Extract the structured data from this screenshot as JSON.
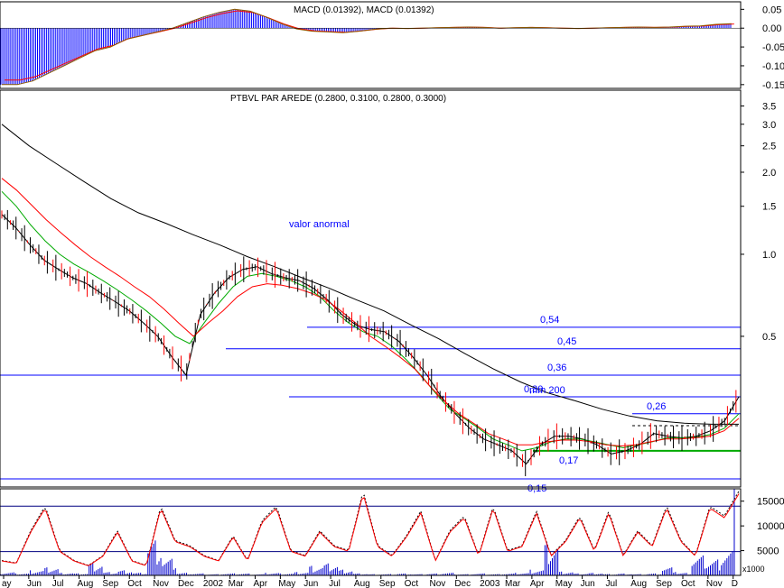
{
  "colors": {
    "blue": "#0000ff",
    "red": "#ff0000",
    "green": "#00aa00",
    "black": "#000000",
    "volume": "#0000cc",
    "grid": "#000080"
  },
  "chart_data": [
    {
      "type": "bar",
      "panel": "macd",
      "title": "MACD (0.01392), MACD (0.01392)",
      "ylim": [
        -0.16,
        0.07
      ],
      "ticks": [
        "0.05",
        "0.00",
        "-0.05",
        "-0.10",
        "-0.15"
      ],
      "tick_values": [
        0.05,
        0.0,
        -0.05,
        -0.1,
        -0.15
      ],
      "series": [
        {
          "values": [
            -0.15,
            -0.15,
            -0.14,
            -0.12,
            -0.1,
            -0.08,
            -0.06,
            -0.05,
            -0.03,
            -0.02,
            -0.01,
            0.0,
            0.015,
            0.03,
            0.042,
            0.05,
            0.045,
            0.03,
            0.012,
            -0.002,
            -0.008,
            -0.01,
            -0.012,
            -0.008,
            -0.003,
            0.0,
            -0.001,
            0.0,
            0.001,
            0.002,
            0.003,
            0.002,
            0.0,
            0.001,
            0.002,
            0.001,
            0.0,
            -0.001,
            0.0,
            0.001,
            0.002,
            0.003,
            0.002,
            0.003,
            0.005,
            0.006,
            0.01,
            0.012
          ]
        }
      ]
    },
    {
      "type": "line",
      "panel": "price",
      "title": "PTBVL PAR AREDE (0.2800, 0.3100, 0.2800, 0.3000)",
      "scale": "log",
      "ylim": [
        0.14,
        4.0
      ],
      "ticks": [
        "3.5",
        "3.0",
        "2.5",
        "2.0",
        "1.5",
        "1.0",
        "0.5"
      ],
      "tick_values": [
        3.5,
        3.0,
        2.5,
        2.0,
        1.5,
        1.0,
        0.5
      ],
      "annotation": "valor anormal",
      "series": [
        {
          "values": [
            1.4,
            1.25,
            1.08,
            0.95,
            0.88,
            0.82,
            0.78,
            0.72,
            0.67,
            0.62,
            0.56,
            0.5,
            0.42,
            0.36,
            0.6,
            0.72,
            0.82,
            0.88,
            0.9,
            0.85,
            0.82,
            0.8,
            0.75,
            0.68,
            0.6,
            0.55,
            0.53,
            0.52,
            0.48,
            0.42,
            0.36,
            0.3,
            0.26,
            0.23,
            0.21,
            0.2,
            0.19,
            0.17,
            0.2,
            0.215,
            0.215,
            0.21,
            0.2,
            0.185,
            0.19,
            0.2,
            0.22,
            0.215,
            0.212,
            0.215,
            0.225,
            0.245,
            0.3
          ]
        },
        {
          "values": [
            1.7,
            1.5,
            1.28,
            1.12,
            1.0,
            0.92,
            0.86,
            0.8,
            0.74,
            0.68,
            0.62,
            0.56,
            0.5,
            0.47,
            0.56,
            0.66,
            0.76,
            0.83,
            0.85,
            0.83,
            0.8,
            0.76,
            0.7,
            0.62,
            0.56,
            0.52,
            0.5,
            0.46,
            0.41,
            0.36,
            0.31,
            0.27,
            0.25,
            0.23,
            0.21,
            0.2,
            0.19,
            0.195,
            0.205,
            0.21,
            0.21,
            0.205,
            0.2,
            0.195,
            0.2,
            0.205,
            0.212,
            0.212,
            0.213,
            0.218,
            0.23,
            0.26
          ]
        },
        {
          "values": [
            1.9,
            1.72,
            1.52,
            1.34,
            1.2,
            1.08,
            0.98,
            0.9,
            0.83,
            0.76,
            0.7,
            0.63,
            0.56,
            0.5,
            0.56,
            0.62,
            0.7,
            0.76,
            0.78,
            0.77,
            0.75,
            0.72,
            0.68,
            0.62,
            0.56,
            0.5,
            0.46,
            0.42,
            0.38,
            0.33,
            0.29,
            0.26,
            0.24,
            0.22,
            0.21,
            0.2,
            0.2,
            0.205,
            0.208,
            0.208,
            0.205,
            0.2,
            0.198,
            0.2,
            0.205,
            0.21,
            0.21,
            0.212,
            0.215,
            0.225,
            0.25
          ]
        },
        {
          "values": [
            3.0,
            2.5,
            2.15,
            1.85,
            1.6,
            1.42,
            1.3,
            1.18,
            1.08,
            0.98,
            0.9,
            0.82,
            0.75,
            0.68,
            0.62,
            0.55,
            0.49,
            0.43,
            0.38,
            0.34,
            0.31,
            0.29,
            0.27,
            0.255,
            0.245,
            0.24,
            0.238,
            0.238
          ]
        }
      ],
      "levels": [
        {
          "label": "0,54",
          "value": 0.54
        },
        {
          "label": "0,45",
          "value": 0.45
        },
        {
          "label": "0,36",
          "value": 0.36
        },
        {
          "label": "0,30",
          "value": 0.3
        },
        {
          "label": "0,26",
          "value": 0.26
        },
        {
          "label": "0,17",
          "value": 0.19
        },
        {
          "label": "0,15",
          "value": 0.15
        }
      ],
      "ma_label": "mm 200"
    },
    {
      "type": "bar",
      "panel": "volume",
      "ylim": [
        0,
        17500
      ],
      "ticks": [
        "15000",
        "10000",
        "5000"
      ],
      "tick_values": [
        15000,
        10000,
        5000
      ],
      "unit_label": "x1000",
      "reference_lines": [
        14000,
        4800
      ],
      "series": [
        {
          "values": [
            3000,
            2500,
            9000,
            14000,
            5000,
            3000,
            2000,
            4000,
            9000,
            3000,
            2000,
            14000,
            7000,
            6000,
            4000,
            3000,
            8000,
            3000,
            11000,
            14000,
            5000,
            4000,
            9000,
            6000,
            5000,
            17000,
            6000,
            4000,
            8000,
            13000,
            3000,
            9000,
            12000,
            4000,
            14000,
            5000,
            6000,
            13000,
            4000,
            7000,
            12000,
            5000,
            13000,
            4000,
            9000,
            6000,
            14000,
            7000,
            4000,
            14000,
            12000,
            17000
          ]
        },
        {
          "values": [
            500,
            300,
            800,
            1200,
            400,
            300,
            2000,
            500,
            800,
            400,
            5500,
            2500,
            400,
            300,
            200,
            300,
            300,
            200,
            400,
            300,
            500,
            1500,
            1800,
            900,
            300,
            200,
            200,
            300,
            200,
            300,
            400,
            200,
            300,
            200,
            300,
            400,
            900,
            5000,
            600,
            300,
            400,
            200,
            300,
            200,
            300,
            1200,
            400,
            3000,
            2500,
            4000,
            17000
          ]
        }
      ],
      "x_labels": [
        "ay",
        "Jun",
        "Jul",
        "Aug",
        "Sep",
        "Oct",
        "Nov",
        "Dec",
        "2002",
        "Mar",
        "Apr",
        "May",
        "Jun",
        "Jul",
        "Aug",
        "Sep",
        "Oct",
        "Nov",
        "Dec",
        "2003",
        "Mar",
        "Apr",
        "May",
        "Jun",
        "Jul",
        "Aug",
        "Sep",
        "Oct",
        "Nov",
        "D"
      ]
    }
  ]
}
